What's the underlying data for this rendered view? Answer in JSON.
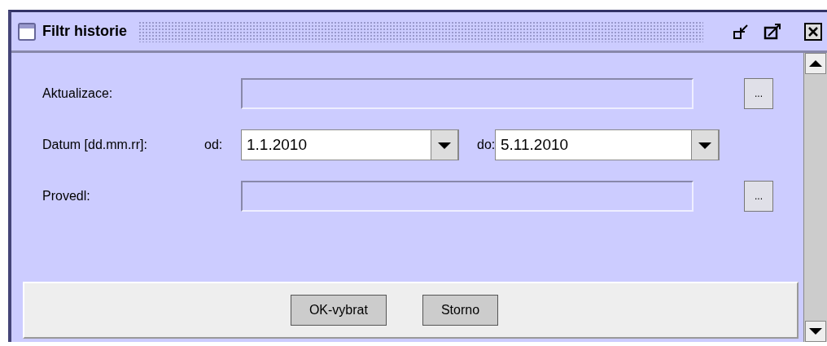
{
  "window": {
    "title": "Filtr historie"
  },
  "rows": [
    {
      "kind": "lookup",
      "label": "Aktualizace:",
      "disabled": true,
      "button": "..."
    },
    {
      "kind": "date-range",
      "label": "Datum [dd.mm.rr]:",
      "from_label": "od:",
      "from": "1.1.2010",
      "to_label": "do:",
      "to": "5.11.2010"
    },
    {
      "kind": "lookup",
      "label": "Provedl:",
      "disabled": true,
      "button": "..."
    }
  ],
  "buttons": [
    "OK-vybrat",
    "Storno"
  ]
}
